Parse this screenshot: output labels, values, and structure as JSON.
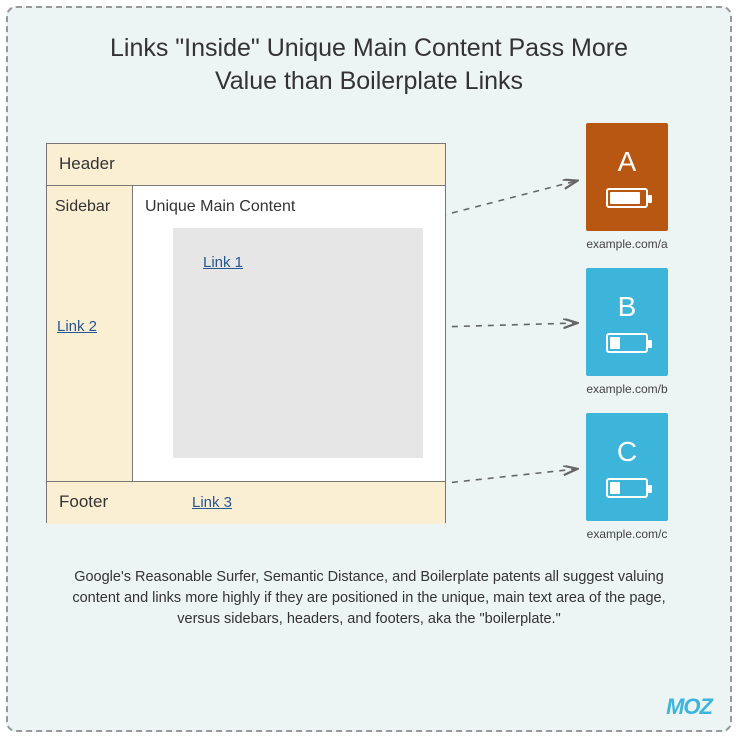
{
  "title": "Links \"Inside\" Unique Main Content Pass More Value than Boilerplate Links",
  "page": {
    "header": "Header",
    "sidebar": "Sidebar",
    "main": "Unique Main Content",
    "footer": "Footer",
    "link1": "Link 1",
    "link2": "Link 2",
    "link3": "Link 3"
  },
  "cards": {
    "a": {
      "letter": "A",
      "caption": "example.com/a"
    },
    "b": {
      "letter": "B",
      "caption": "example.com/b"
    },
    "c": {
      "letter": "C",
      "caption": "example.com/c"
    }
  },
  "caption": "Google's Reasonable Surfer, Semantic Distance, and Boilerplate patents all suggest valuing content and links more highly if they are positioned in the unique, main text area of the page, versus sidebars, headers, and footers, aka the \"boilerplate.\"",
  "logo": "MOZ"
}
